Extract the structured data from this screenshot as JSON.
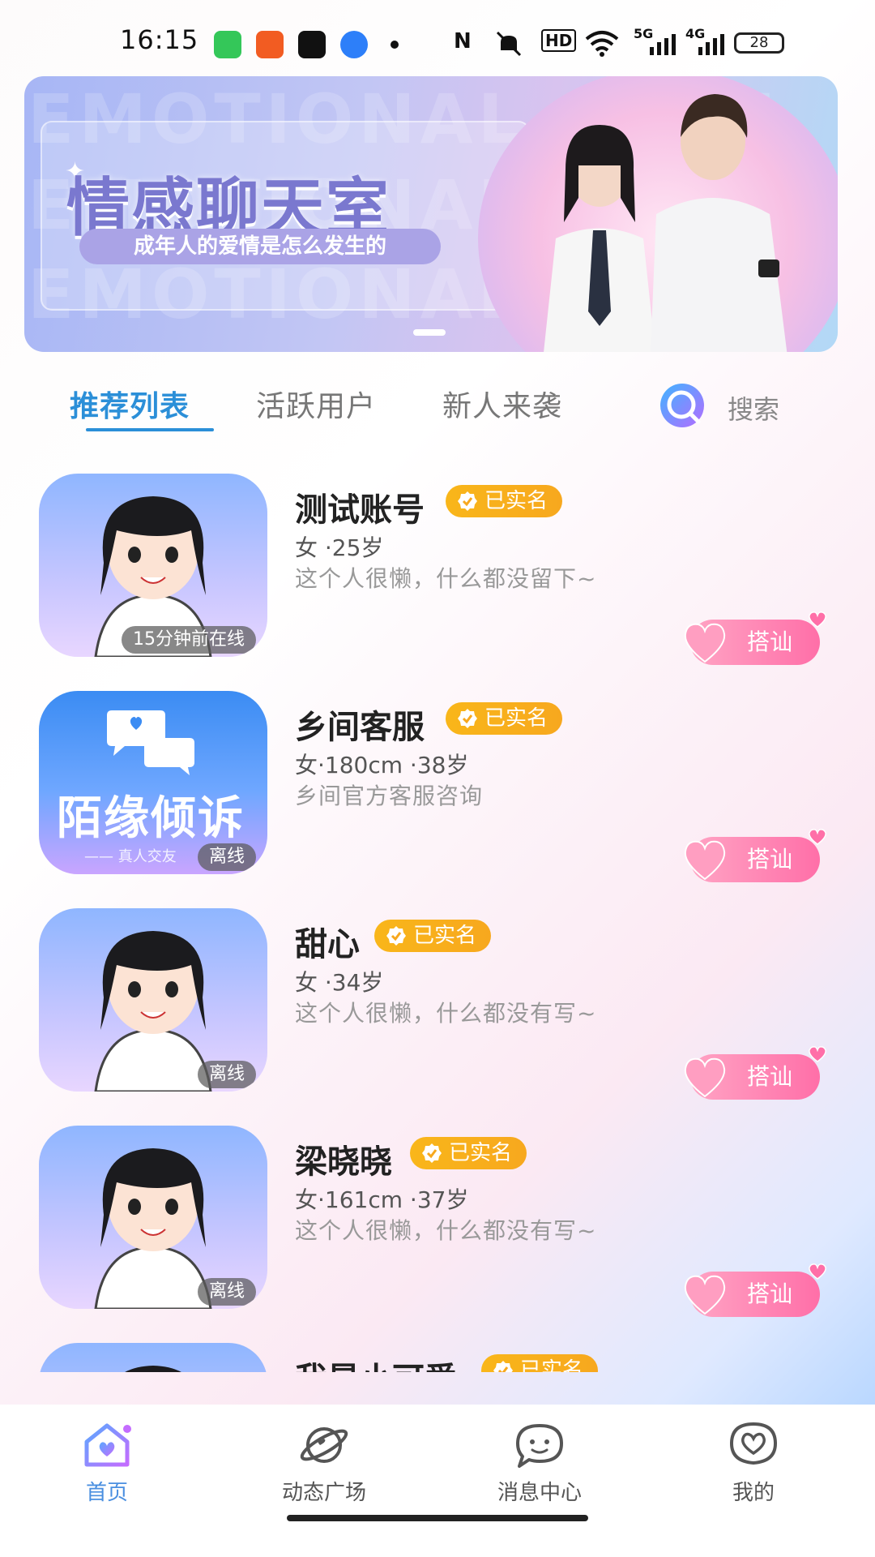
{
  "status_bar": {
    "time": "16:15",
    "network_labels": [
      "N",
      "HD",
      "5G",
      "4G"
    ],
    "battery": "28"
  },
  "banner": {
    "watermark": "EMOTIONAL CHAT",
    "title": "情感聊天室",
    "subtitle": "成年人的爱情是怎么发生的"
  },
  "tabs": {
    "items": [
      "推荐列表",
      "活跃用户",
      "新人来袭"
    ],
    "active_index": 0,
    "search_label": "搜索"
  },
  "users": [
    {
      "name": "测试账号",
      "badge": "已实名",
      "meta": "女 ·25岁",
      "bio": "这个人很懒，什么都没留下~",
      "status": "15分钟前在线",
      "avatar": "girl-avatar"
    },
    {
      "name": "乡间客服",
      "badge": "已实名",
      "meta": "女·180cm ·38岁",
      "bio": "乡间官方客服咨询",
      "status": "离线",
      "avatar": "service-logo",
      "avatar_text": "陌缘倾诉",
      "avatar_sub": "—— 真人交友"
    },
    {
      "name": "甜心",
      "badge": "已实名",
      "meta": "女 ·34岁",
      "bio": "这个人很懒，什么都没有写~",
      "status": "离线",
      "avatar": "girl-avatar"
    },
    {
      "name": "梁晓晓",
      "badge": "已实名",
      "meta": "女·161cm ·37岁",
      "bio": "这个人很懒，什么都没有写~",
      "status": "离线",
      "avatar": "girl-avatar"
    },
    {
      "name": "我是小可爱",
      "badge": "已实名",
      "avatar": "girl-avatar"
    }
  ],
  "chat_button_label": "搭讪",
  "bottom_nav": [
    {
      "label": "首页",
      "icon": "home-icon",
      "active": true
    },
    {
      "label": "动态广场",
      "icon": "planet-icon",
      "active": false
    },
    {
      "label": "消息中心",
      "icon": "message-icon",
      "active": false
    },
    {
      "label": "我的",
      "icon": "profile-heart-icon",
      "active": false
    }
  ],
  "colors": {
    "accent": "#2b8fd8",
    "badge": "#f9b61a",
    "chat_button": "#ff6fa8"
  }
}
